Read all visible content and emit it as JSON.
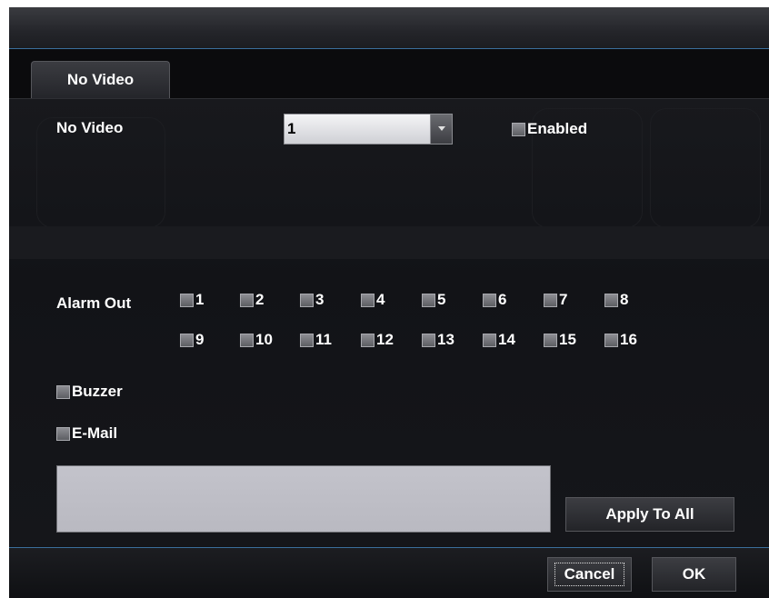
{
  "tabs": [
    {
      "label": "No Video",
      "active": true
    }
  ],
  "no_video": {
    "label": "No Video",
    "select_value": "1",
    "enabled_label": "Enabled",
    "enabled_checked": false
  },
  "alarm_out": {
    "label": "Alarm Out",
    "channels": [
      "1",
      "2",
      "3",
      "4",
      "5",
      "6",
      "7",
      "8",
      "9",
      "10",
      "11",
      "12",
      "13",
      "14",
      "15",
      "16"
    ]
  },
  "buzzer": {
    "label": "Buzzer",
    "checked": false
  },
  "email": {
    "label": "E-Mail",
    "checked": false,
    "text": ""
  },
  "buttons": {
    "apply_to_all": "Apply To All",
    "cancel": "Cancel",
    "ok": "OK"
  },
  "colors": {
    "background": "#131418",
    "accent_line": "#3b6f9c",
    "text": "#ffffff"
  }
}
